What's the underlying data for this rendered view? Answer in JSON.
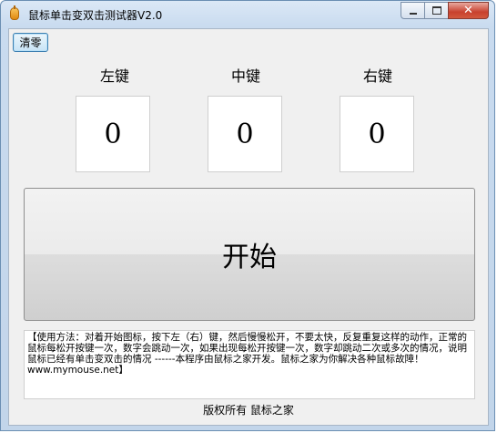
{
  "window": {
    "title": "鼠标单击变双击测试器V2.0",
    "close_glyph": "✕"
  },
  "toolbar": {
    "clear_label": "清零"
  },
  "keys": [
    {
      "label": "左键",
      "count": "0"
    },
    {
      "label": "中键",
      "count": "0"
    },
    {
      "label": "右键",
      "count": "0"
    }
  ],
  "start_label": "开始",
  "info_text": "【使用方法：对着开始图标，按下左（右）键，然后慢慢松开，不要太快，反复重复这样的动作，正常的鼠标每松开按键一次，数字会跳动一次，如果出现每松开按键一次，数字却跳动二次或多次的情况，说明鼠标已经有单击变双击的情况 ------本程序由鼠标之家开发。鼠标之家为你解决各种鼠标故障！ www.mymouse.net】",
  "footer": "版权所有 鼠标之家",
  "colors": {
    "titlebar": "#dbe8f6",
    "close": "#c8412e",
    "client": "#f0f0f0"
  }
}
